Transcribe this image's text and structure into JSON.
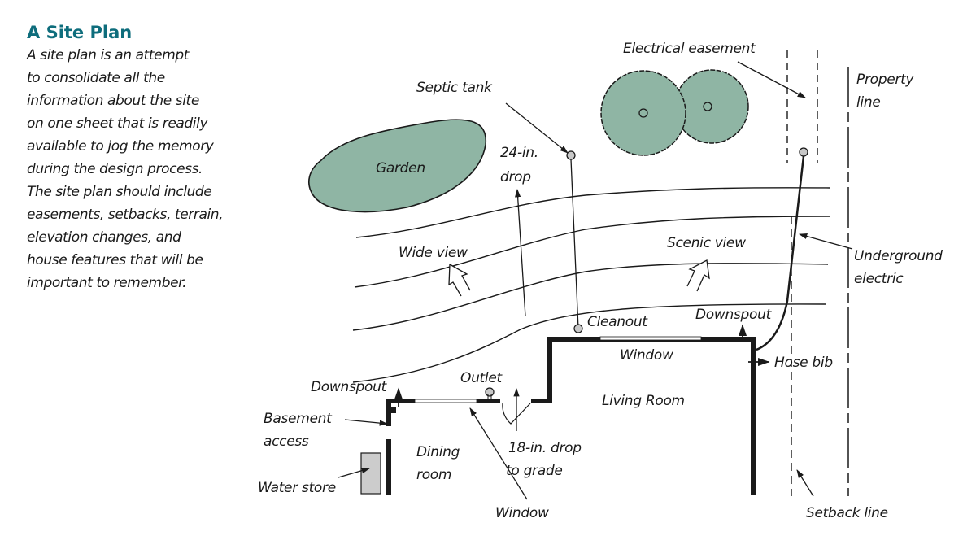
{
  "sidebar": {
    "title": "A Site Plan",
    "description_lines": [
      "A site plan is an attempt",
      "to consolidate all the",
      "information about the site",
      "on one sheet that is readily",
      "available to jog the memory",
      "during the design process.",
      "The site plan should include",
      "easements, setbacks, terrain,",
      "elevation changes, and",
      "house features that will be",
      "important to remember."
    ]
  },
  "colors": {
    "title": "#0e6d7c",
    "vegetation": "#8fb5a4",
    "marker_fill": "#c8c8c8",
    "water_store_fill": "#cccccc",
    "ink": "#1a1a1a"
  },
  "labels": {
    "electrical_easement": "Electrical easement",
    "property_line_1": "Property",
    "property_line_2": "line",
    "septic_tank": "Septic tank",
    "garden": "Garden",
    "drop_24_1": "24-in.",
    "drop_24_2": "drop",
    "wide_view": "Wide view",
    "scenic_view": "Scenic view",
    "underground_electric_1": "Underground",
    "underground_electric_2": "electric",
    "cleanout": "Cleanout",
    "downspout_right": "Downspout",
    "window_top": "Window",
    "hose_bib": "Hose bib",
    "living_room": "Living Room",
    "outlet": "Outlet",
    "downspout_left": "Downspout",
    "basement_access_1": "Basement",
    "basement_access_2": "access",
    "dining_room_1": "Dining",
    "dining_room_2": "room",
    "drop_18_1": "18-in. drop",
    "drop_18_2": "to grade",
    "water_store": "Water store",
    "window_bottom": "Window",
    "setback_line": "Setback line"
  }
}
